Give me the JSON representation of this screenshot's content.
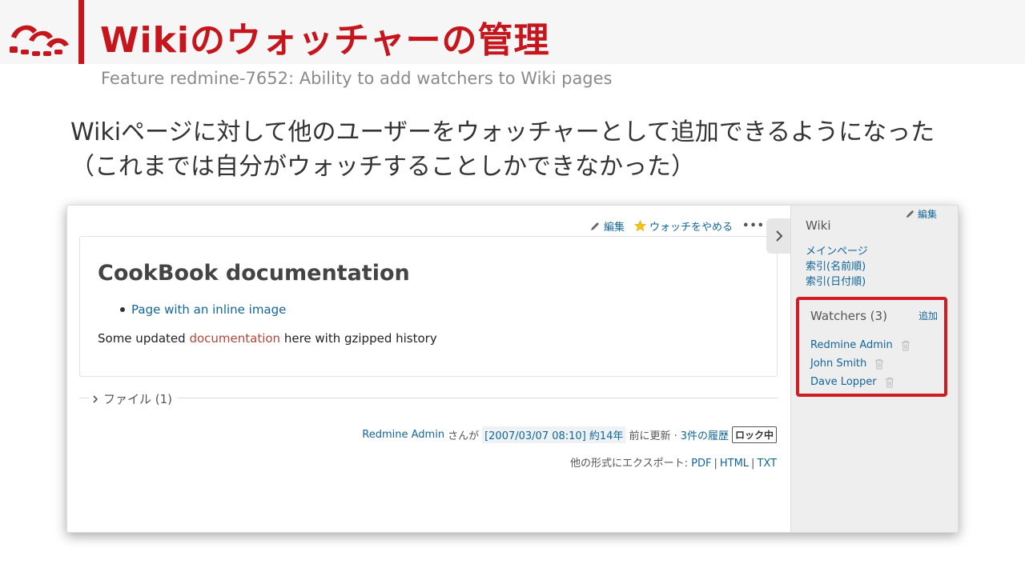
{
  "slide": {
    "title": "Wikiのウォッチャーの管理",
    "subtitle": "Feature redmine-7652: Ability to add watchers to Wiki pages",
    "body": "Wikiページに対して他のユーザーをウォッチャーとして追加できるようになった（これまでは自分がウォッチすることしかできなかった）"
  },
  "page": {
    "contextual": {
      "edit_label": "編集",
      "unwatch_label": "ウォッチをやめる",
      "more_label": "•••"
    },
    "title": "CookBook documentation",
    "list_link": "Page with an inline image",
    "text_before": "Some updated ",
    "text_link": "documentation",
    "text_after": " here with gzipped history",
    "files_label": "ファイル (1)",
    "updated": {
      "author": "Redmine Admin",
      "by": "さんが",
      "stamp": "[2007/03/07 08:10] 約14年",
      "suffix": "前に更新 ·",
      "history": "3件の履歴",
      "lock": "ロック中"
    },
    "export": {
      "label": "他の形式にエクスポート:",
      "pdf": "PDF",
      "html": "HTML",
      "txt": "TXT"
    }
  },
  "sidebar": {
    "edit_label": "編集",
    "title": "Wiki",
    "links": [
      "メインページ",
      "索引(名前順)",
      "索引(日付順)"
    ],
    "watchers": {
      "title": "Watchers (3)",
      "add_label": "追加",
      "users": [
        "Redmine Admin",
        "John Smith",
        "Dave Lopper"
      ]
    }
  },
  "colors": {
    "accent_red": "#c4161c",
    "link_blue": "#116699",
    "highlight_border": "#d01c23"
  }
}
